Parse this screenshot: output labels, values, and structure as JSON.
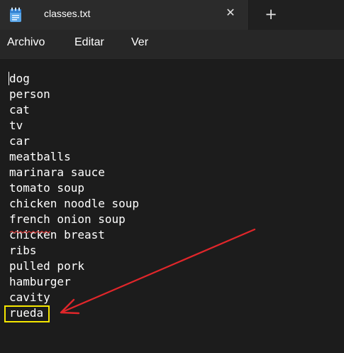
{
  "window": {
    "tab_title": "classes.txt",
    "close_glyph": "✕",
    "new_tab_glyph": "+"
  },
  "menu": {
    "items": [
      "Archivo",
      "Editar",
      "Ver"
    ]
  },
  "document": {
    "lines": [
      "dog",
      "person",
      "cat",
      "tv",
      "car",
      "meatballs",
      "marinara sauce",
      "tomato soup",
      "chicken noodle soup",
      "french onion soup",
      "chicken breast",
      "ribs",
      "pulled pork",
      "hamburger",
      "cavity",
      "rueda"
    ],
    "spellcheck_flagged_word": "french",
    "highlighted_line": "rueda"
  },
  "annotations": {
    "highlight_color": "#f5e600",
    "arrow_color": "#e0262a",
    "spellcheck_color": "#d83b3b"
  },
  "icons": {
    "app": "notepad-icon",
    "close": "close-icon",
    "new_tab": "plus-icon"
  }
}
